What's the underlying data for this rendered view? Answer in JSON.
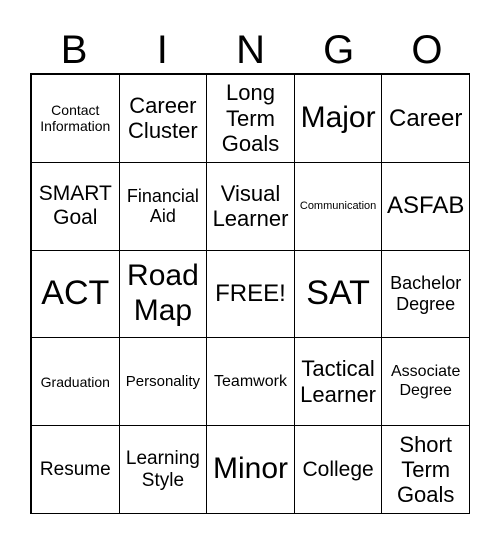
{
  "header": [
    "B",
    "I",
    "N",
    "G",
    "O"
  ],
  "cells": [
    "Contact Information",
    "Career Cluster",
    "Long Term Goals",
    "Major",
    "Career",
    "SMART Goal",
    "Financial Aid",
    "Visual Learner",
    "Communication",
    "ASFAB",
    "ACT",
    "Road Map",
    "FREE!",
    "SAT",
    "Bachelor Degree",
    "Graduation",
    "Personality",
    "Teamwork",
    "Tactical Learner",
    "Associate Degree",
    "Resume",
    "Learning Style",
    "Minor",
    "College",
    "Short Term Goals"
  ]
}
